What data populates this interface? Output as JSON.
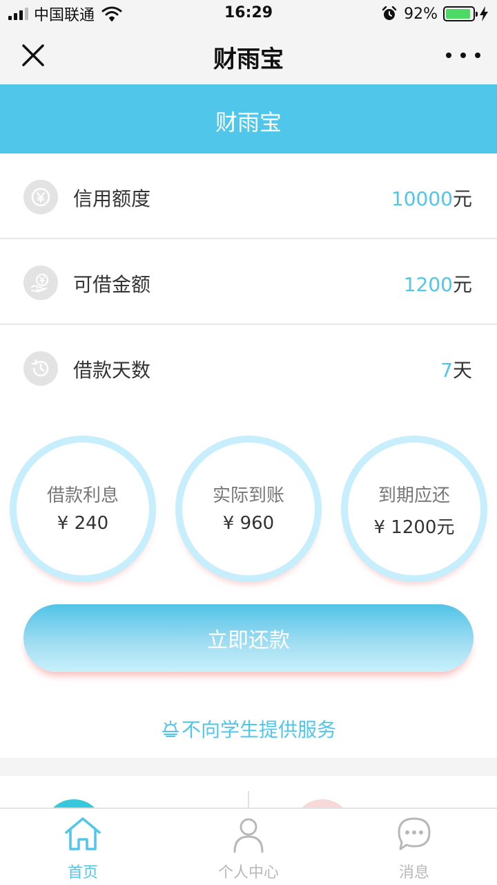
{
  "status_bar": {
    "carrier": "中国联通",
    "time": "16:29",
    "battery_percent": "92%",
    "battery_level": 0.92,
    "icons": [
      "signal-icon",
      "wifi-icon",
      "alarm-icon",
      "battery-icon",
      "charging-icon"
    ]
  },
  "nav": {
    "title": "财雨宝",
    "close_icon": "close-icon",
    "more_icon": "more-icon"
  },
  "banner": {
    "title": "财雨宝"
  },
  "info_rows": [
    {
      "icon": "yen-coin-icon",
      "label": "信用额度",
      "value": "10000",
      "unit": "元"
    },
    {
      "icon": "money-hand-icon",
      "label": "可借金额",
      "value": "1200",
      "unit": "元"
    },
    {
      "icon": "history-clock-icon",
      "label": "借款天数",
      "value": "7",
      "unit": "天"
    }
  ],
  "summary": [
    {
      "label": "借款利息",
      "value": "¥ 240"
    },
    {
      "label": "实际到账",
      "value": "¥ 960"
    },
    {
      "label": "到期应还",
      "value": "¥ 1200元"
    }
  ],
  "repay_button": {
    "label": "立即还款"
  },
  "notice": {
    "icon": "bell-icon",
    "text": "不向学生提供服务"
  },
  "tabs": [
    {
      "label": "首页",
      "icon": "home-icon",
      "active": true
    },
    {
      "label": "个人中心",
      "icon": "user-icon",
      "active": false
    },
    {
      "label": "消息",
      "icon": "chat-icon",
      "active": false
    }
  ],
  "colors": {
    "accent": "#4fc6ea",
    "circle_ring": "#c7eefc",
    "battery": "#4cd964",
    "lower_teal": "#37c8de",
    "lower_pink": "#f7d9d9"
  }
}
